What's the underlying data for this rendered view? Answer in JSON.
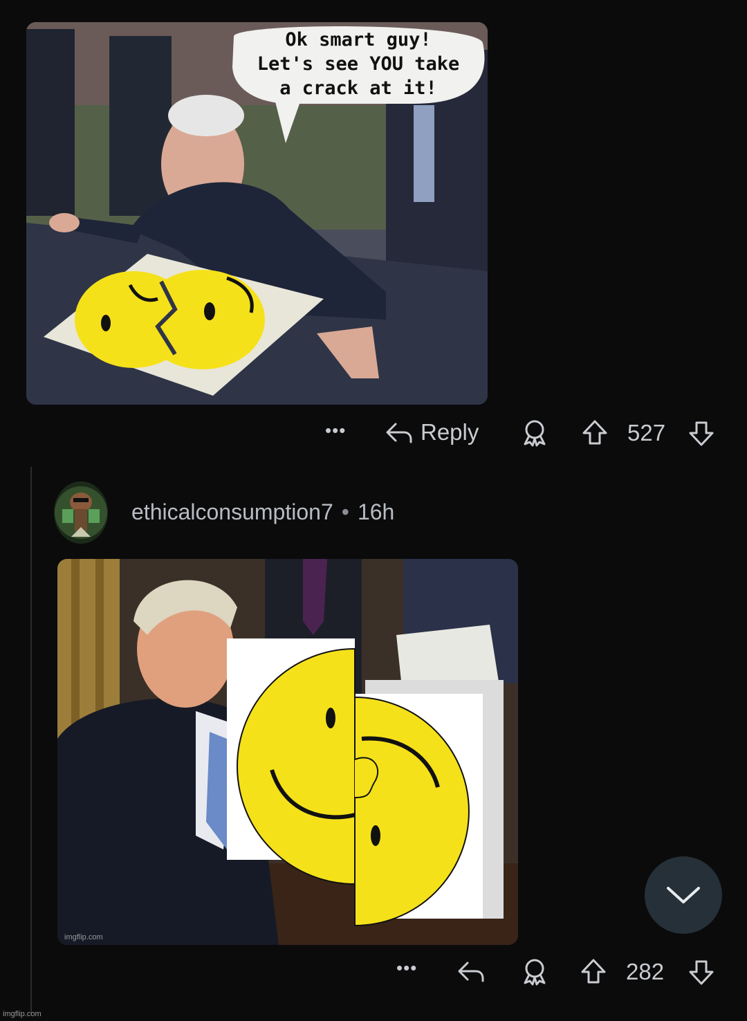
{
  "comment1": {
    "image": {
      "speech_bubble": [
        "Ok smart guy!",
        "Let's see YOU take",
        "a crack at it!"
      ]
    },
    "actions": {
      "more": "•••",
      "reply_label": "Reply",
      "score": "527"
    }
  },
  "comment2": {
    "username": "ethicalconsumption7",
    "separator": "•",
    "age": "16h",
    "image": {
      "credit": "imgflip.com"
    },
    "actions": {
      "more": "•••",
      "score": "282"
    }
  },
  "watermark": "imgflip.com",
  "colors": {
    "background": "#0b0b0c",
    "text": "#c9ccd0",
    "scroll_button": "#253038",
    "smiley": "#f5e11a"
  }
}
